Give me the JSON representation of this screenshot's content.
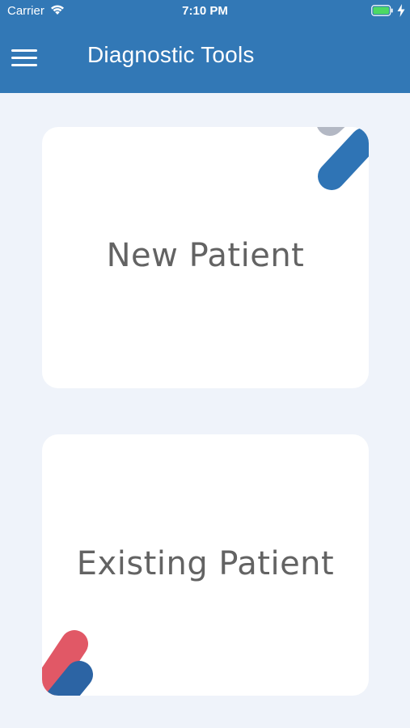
{
  "status_bar": {
    "carrier": "Carrier",
    "time": "7:10 PM",
    "wifi_icon": "wifi-icon",
    "battery_icon": "battery-charging-icon",
    "battery_color": "#4cd964"
  },
  "header": {
    "title": "Diagnostic Tools",
    "menu_icon": "hamburger-menu-icon",
    "background_color": "#3278b6"
  },
  "cards": [
    {
      "label": "New Patient"
    },
    {
      "label": "Existing Patient"
    }
  ],
  "colors": {
    "page_background": "#eff3fa",
    "card_background": "#ffffff",
    "card_text": "#636363",
    "accent_blue": "#2f74b5",
    "accent_gray": "#b3b8c4",
    "accent_red": "#e15866"
  }
}
